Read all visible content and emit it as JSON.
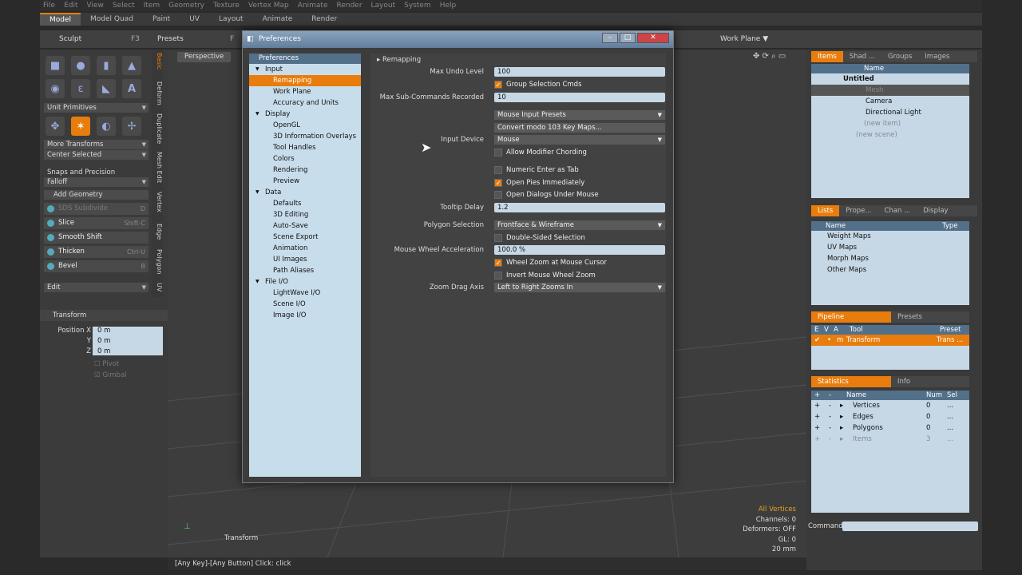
{
  "menubar": [
    "File",
    "Edit",
    "View",
    "Select",
    "Item",
    "Geometry",
    "Texture",
    "Vertex Map",
    "Animate",
    "Render",
    "Layout",
    "System",
    "Help"
  ],
  "tabs": [
    {
      "label": "Model",
      "active": true
    },
    {
      "label": "Model Quad"
    },
    {
      "label": "Paint"
    },
    {
      "label": "UV"
    },
    {
      "label": "Layout"
    },
    {
      "label": "Animate"
    },
    {
      "label": "Render"
    }
  ],
  "toolbar": {
    "sculpt": "Sculpt",
    "sculpt_key": "F3",
    "presets": "Presets",
    "work_plane": "Work Plane",
    "f_key": "F"
  },
  "left": {
    "unit_primitives": "Unit Primitives",
    "more_transforms": "More Transforms",
    "center_selected": "Center Selected",
    "snaps": "Snaps and Precision",
    "falloff": "Falloff",
    "add_geometry": "Add Geometry",
    "tools": [
      {
        "label": "SDS Subdivide",
        "key": "D",
        "dim": true
      },
      {
        "label": "Slice",
        "key": "Shift-C"
      },
      {
        "label": "Smooth Shift",
        "key": ""
      },
      {
        "label": "Thicken",
        "key": "Ctrl-U"
      },
      {
        "label": "Bevel",
        "key": "B"
      }
    ],
    "edit": "Edit",
    "transform": "Transform",
    "position_x": "Position X",
    "y": "Y",
    "z": "Z",
    "val": "0 m",
    "pivot": "Pivot",
    "gimbal": "Gimbal"
  },
  "vtabs": [
    "Basic",
    "Deform",
    "Duplicate",
    "Mesh Edit",
    "Vertex",
    "Edge",
    "Polygon",
    "UV"
  ],
  "viewport": {
    "tab": "Perspective",
    "transform": "Transform",
    "info": [
      "All Vertices",
      "Channels: 0",
      "Deformers: OFF",
      "GL: 0",
      "20 mm"
    ]
  },
  "status": "[Any Key]-[Any Button] Click:  click",
  "items_panel": {
    "tabs": [
      "Items",
      "Shad ...",
      "Groups",
      "Images"
    ],
    "name_col": "Name",
    "rows": [
      "Untitled",
      "Mesh",
      "Camera",
      "Directional Light",
      "(new item)",
      "(new scene)"
    ]
  },
  "lists_panel": {
    "tabs": [
      "Lists",
      "Prope...",
      "Chan ...",
      "Display"
    ],
    "name": "Name",
    "type": "Type",
    "rows": [
      "Weight Maps",
      "UV Maps",
      "Morph Maps",
      "Other Maps"
    ]
  },
  "pipeline": {
    "tab1": "Pipeline",
    "tab2": "Presets",
    "cols": [
      "E",
      "V",
      "A",
      "Tool",
      "Preset"
    ],
    "row": {
      "check": "✔",
      "dot": "•",
      "m": "m",
      "tool": "Transform",
      "preset": "Trans ..."
    }
  },
  "stats": {
    "tab1": "Statistics",
    "tab2": "Info",
    "cols": [
      "+",
      "-",
      "Name",
      "Num",
      "Sel"
    ],
    "rows": [
      {
        "name": "Vertices",
        "num": "0",
        "sel": "..."
      },
      {
        "name": "Edges",
        "num": "0",
        "sel": "..."
      },
      {
        "name": "Polygons",
        "num": "0",
        "sel": "..."
      },
      {
        "name": "Items",
        "num": "3",
        "sel": "..."
      }
    ]
  },
  "command": "Command",
  "dialog": {
    "title": "Preferences",
    "tree_header": "Preferences",
    "tree": [
      {
        "label": "Input",
        "level": 0,
        "exp": "▼"
      },
      {
        "label": "Remapping",
        "level": 1,
        "sel": true
      },
      {
        "label": "Work Plane",
        "level": 1
      },
      {
        "label": "Accuracy and Units",
        "level": 1
      },
      {
        "label": "Display",
        "level": 0,
        "exp": "▼"
      },
      {
        "label": "OpenGL",
        "level": 1
      },
      {
        "label": "3D Information Overlays",
        "level": 1
      },
      {
        "label": "Tool Handles",
        "level": 1
      },
      {
        "label": "Colors",
        "level": 1
      },
      {
        "label": "Rendering",
        "level": 1
      },
      {
        "label": "Preview",
        "level": 1
      },
      {
        "label": "Data",
        "level": 0,
        "exp": "▼"
      },
      {
        "label": "Defaults",
        "level": 1
      },
      {
        "label": "3D Editing",
        "level": 1
      },
      {
        "label": "Auto-Save",
        "level": 1
      },
      {
        "label": "Scene Export",
        "level": 1
      },
      {
        "label": "Animation",
        "level": 1
      },
      {
        "label": "UI Images",
        "level": 1
      },
      {
        "label": "Path Aliases",
        "level": 1
      },
      {
        "label": "File I/O",
        "level": 0,
        "exp": "▼"
      },
      {
        "label": "LightWave I/O",
        "level": 1
      },
      {
        "label": "Scene I/O",
        "level": 1
      },
      {
        "label": "Image I/O",
        "level": 1
      }
    ],
    "section": "Remapping",
    "max_undo_label": "Max Undo Level",
    "max_undo": "100",
    "group_sel": "Group Selection Cmds",
    "max_sub_label": "Max Sub-Commands Recorded",
    "max_sub": "10",
    "mouse_presets": "Mouse Input Presets",
    "convert": "Convert modo 103 Key Maps...",
    "input_device_label": "Input Device",
    "input_device": "Mouse",
    "allow_mod": "Allow Modifier Chording",
    "numeric_tab": "Numeric Enter as Tab",
    "open_pies": "Open Pies Immediately",
    "open_dialogs": "Open Dialogs Under Mouse",
    "tooltip_label": "Tooltip Delay",
    "tooltip": "1.2",
    "polysel_label": "Polygon Selection",
    "polysel": "Frontface & Wireframe",
    "double_sided": "Double-Sided Selection",
    "wheel_label": "Mouse Wheel Acceleration",
    "wheel": "100.0 %",
    "wheel_zoom": "Wheel Zoom at Mouse Cursor",
    "invert_wheel": "Invert Mouse Wheel Zoom",
    "zoom_label": "Zoom Drag Axis",
    "zoom": "Left to Right Zooms In"
  }
}
